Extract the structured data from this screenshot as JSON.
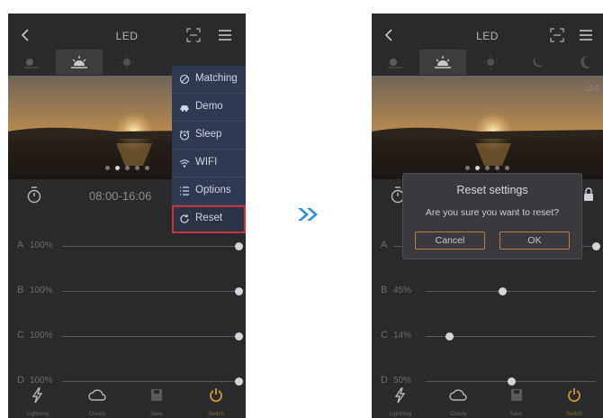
{
  "app": {
    "title": "LED"
  },
  "timer": {
    "range": "08:00-16:06"
  },
  "photo": {
    "clock_readout": "13:5"
  },
  "menu_items": [
    {
      "label": "Matching",
      "icon": "matching-icon"
    },
    {
      "label": "Demo",
      "icon": "demo-icon"
    },
    {
      "label": "Sleep",
      "icon": "sleep-icon"
    },
    {
      "label": "WIFI",
      "icon": "wifi-icon"
    },
    {
      "label": "Options",
      "icon": "options-icon"
    },
    {
      "label": "Reset",
      "icon": "reset-icon",
      "highlighted": true
    }
  ],
  "screen1": {
    "channels": [
      {
        "letter": "A",
        "value": "100%",
        "level": 1.0
      },
      {
        "letter": "B",
        "value": "100%",
        "level": 1.0
      },
      {
        "letter": "C",
        "value": "100%",
        "level": 1.0
      },
      {
        "letter": "D",
        "value": "100%",
        "level": 1.0
      }
    ]
  },
  "screen2": {
    "channels": [
      {
        "letter": "A",
        "value": "",
        "level": 1.0
      },
      {
        "letter": "B",
        "value": "45%",
        "level": 0.45
      },
      {
        "letter": "C",
        "value": "14%",
        "level": 0.14
      },
      {
        "letter": "D",
        "value": "50%",
        "level": 0.5
      }
    ]
  },
  "dialog": {
    "title": "Reset settings",
    "message": "Are you sure you want to reset?",
    "cancel": "Cancel",
    "ok": "OK"
  },
  "tabs": [
    {
      "label": "Lightning",
      "icon": "lightning-icon"
    },
    {
      "label": "Cloudy",
      "icon": "cloud-icon"
    },
    {
      "label": "Save",
      "icon": "save-icon"
    },
    {
      "label": "Switch",
      "icon": "power-icon",
      "active": true
    }
  ],
  "colors": {
    "background": "#2a2a2c",
    "menu_bg": "#2f3a52",
    "highlight": "#c8323b",
    "accent": "#d49a2a",
    "arrow": "#2a8fd6"
  }
}
